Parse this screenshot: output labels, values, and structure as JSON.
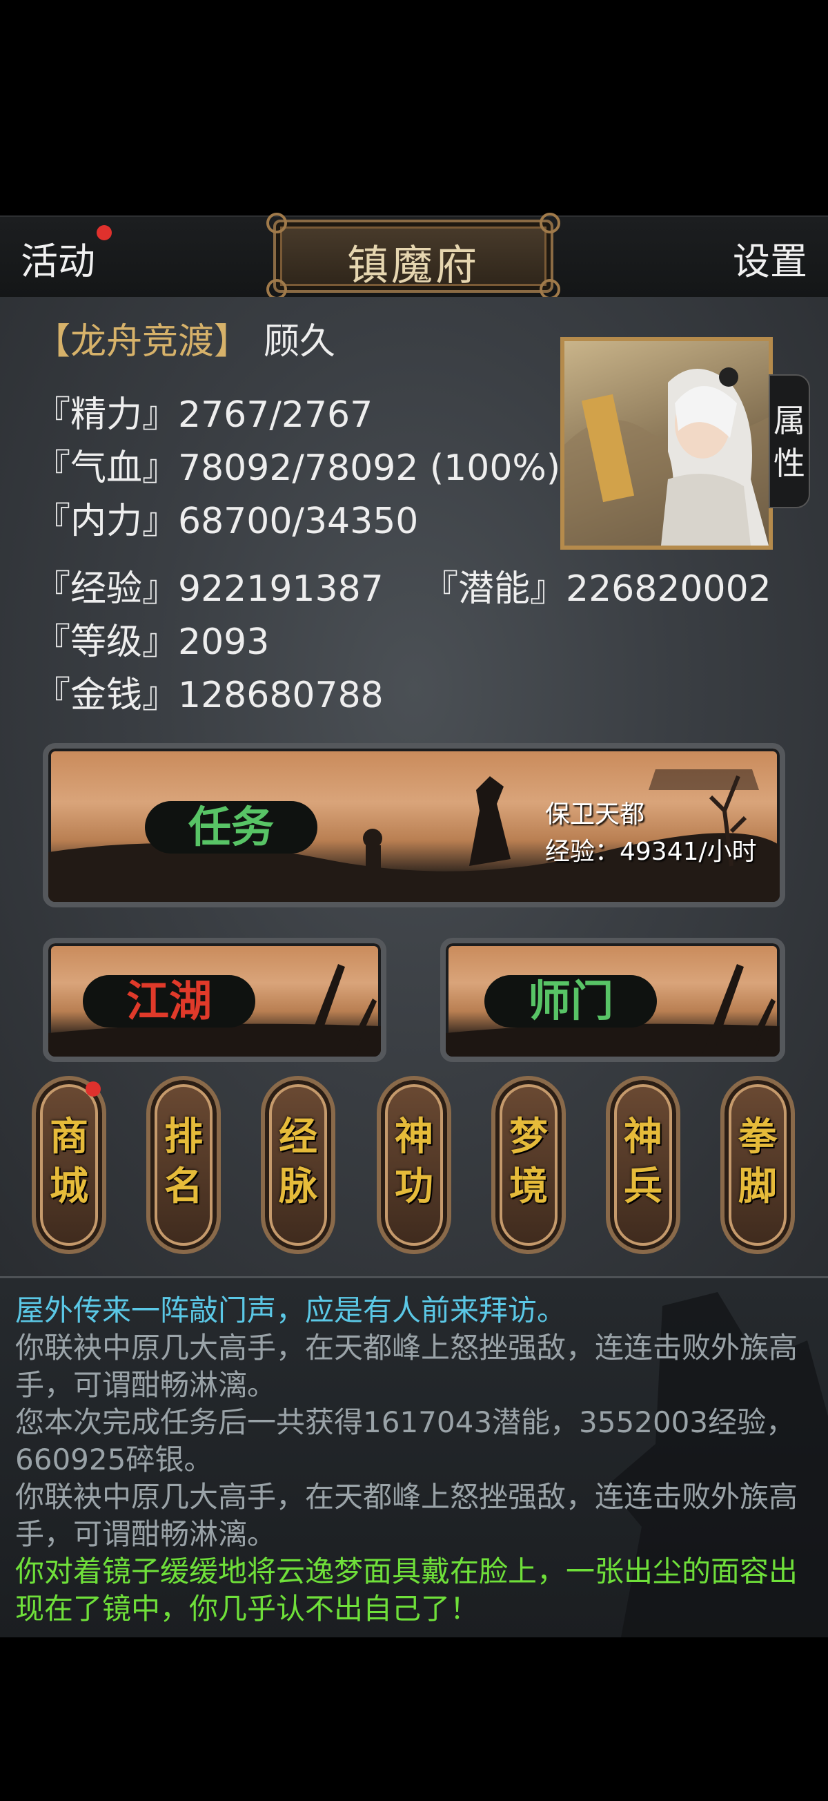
{
  "header": {
    "activity_label": "活动",
    "title": "镇魔府",
    "settings_label": "设置"
  },
  "player": {
    "title": "【龙舟竞渡】",
    "name": "顾久",
    "stamina": "『精力』2767/2767",
    "health": "『气血』78092/78092 (100%)",
    "internal": "『内力』68700/34350",
    "exp": "『经验』922191387",
    "potential": "『潜能』226820002",
    "level": "『等级』2093",
    "money": "『金钱』128680788"
  },
  "attr_tab_label": "属性",
  "quest": {
    "button_label": "任务",
    "quest_name": "保卫天都",
    "exp_rate": "经验：49341/小时"
  },
  "jianghu_label": "江湖",
  "shimen_label": "师门",
  "menu_buttons": [
    {
      "label": "商城",
      "badge": true
    },
    {
      "label": "排名",
      "badge": false
    },
    {
      "label": "经脉",
      "badge": false
    },
    {
      "label": "神功",
      "badge": false
    },
    {
      "label": "梦境",
      "badge": false
    },
    {
      "label": "神兵",
      "badge": false
    },
    {
      "label": "拳脚",
      "badge": false
    }
  ],
  "log": [
    {
      "text": "屋外传来一阵敲门声，应是有人前来拜访。",
      "color": "#5bc8e6"
    },
    {
      "text": "你联袂中原几大高手，在天都峰上怒挫强敌，连连击败外族高手，可谓酣畅淋漓。",
      "color": "#9aa3a8"
    },
    {
      "text": "您本次完成任务后一共获得1617043潜能，3552003经验，660925碎银。",
      "color": "#9aa3a8"
    },
    {
      "text": "你联袂中原几大高手，在天都峰上怒挫强敌，连连击败外族高手，可谓酣畅淋漓。",
      "color": "#9aa3a8"
    },
    {
      "text": "你对着镜子缓缓地将云逸梦面具戴在脸上，一张出尘的面容出现在了镜中，你几乎认不出自己了！",
      "color": "#6fe03a"
    }
  ],
  "colors": {
    "title_gold": "#d7b26a",
    "quest_green": "#58c466",
    "jianghu_red": "#e03a2a",
    "menu_gold": "#e6bb3a",
    "badge_red": "#e0312d"
  }
}
